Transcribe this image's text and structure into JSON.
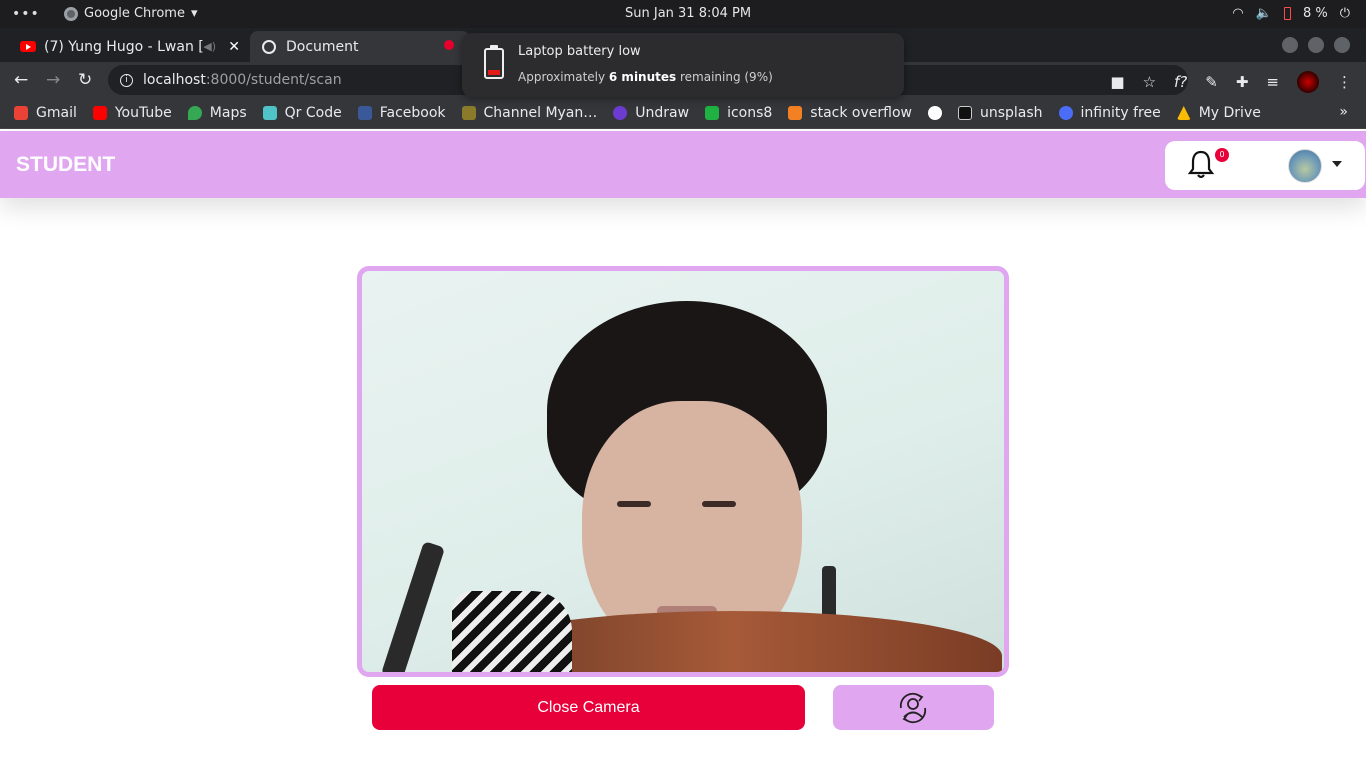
{
  "os": {
    "app_name": "Google Chrome",
    "clock": "Sun Jan 31   8:04 PM",
    "battery_percent": "8 %"
  },
  "browser": {
    "tabs": [
      {
        "label": "(7) Yung Hugo - Lwan [",
        "icon": "youtube-icon"
      },
      {
        "label": "Document",
        "icon": "globe-icon"
      }
    ],
    "url_host": "localhost",
    "url_path": ":8000/student/scan",
    "bookmarks": [
      {
        "label": "Gmail",
        "color": "#ea4335"
      },
      {
        "label": "YouTube",
        "color": "#ff0000"
      },
      {
        "label": "Maps",
        "color": "#34a853"
      },
      {
        "label": "Qr Code",
        "color": "#4fc3c7"
      },
      {
        "label": "Facebook",
        "color": "#3b5998"
      },
      {
        "label": "Channel Myan…",
        "color": "#8a7a2a"
      },
      {
        "label": "Undraw",
        "color": "#6c3cd1"
      },
      {
        "label": "icons8",
        "color": "#1fb141"
      },
      {
        "label": "stack overflow",
        "color": "#f48024"
      },
      {
        "label": "",
        "color": "#ffffff"
      },
      {
        "label": "unsplash",
        "color": "#111111"
      },
      {
        "label": "infinity free",
        "color": "#4a6cf7"
      },
      {
        "label": "My Drive",
        "color": "#fbbc04"
      }
    ]
  },
  "notification": {
    "title": "Laptop battery low",
    "body_prefix": "Approximately ",
    "body_bold": "6 minutes",
    "body_suffix": " remaining (9%)"
  },
  "page": {
    "brand": "STUDENT",
    "notification_count": "0",
    "close_camera_label": "Close Camera",
    "accent_color": "#e0a6f0",
    "danger_color": "#e8003a"
  }
}
